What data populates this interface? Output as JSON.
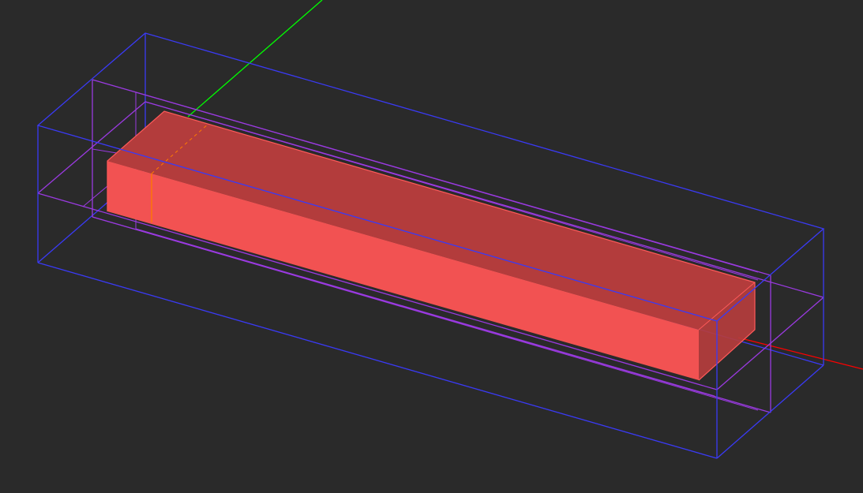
{
  "viewport": {
    "background_color": "#2a2a2a",
    "colors": {
      "bounding_box": "#3a3af5",
      "secondary_box": "#9a3ae0",
      "solid_front": "#f25252",
      "solid_top": "#b33c3c",
      "solid_side": "#b53d3d",
      "edge_highlight": "#ff5a5a",
      "section_line": "#ff7a00",
      "axis_x": "#ff0000",
      "axis_y": "#00ff00"
    }
  }
}
